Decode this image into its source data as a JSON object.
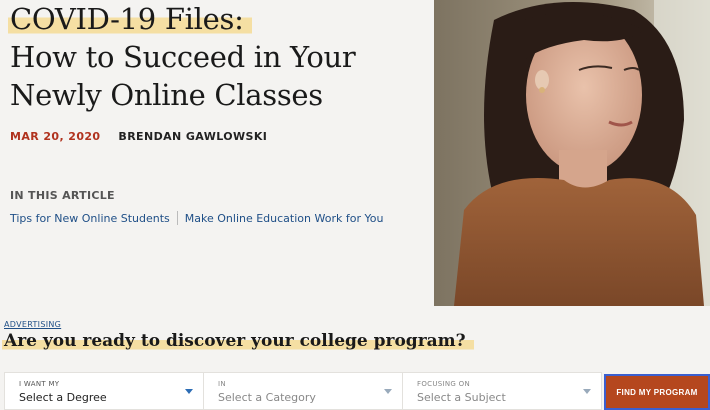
{
  "article": {
    "title_line1": "COVID-19 Files:",
    "title_line2": "How to Succeed in Your",
    "title_line3": "Newly Online Classes",
    "date": "MAR 20, 2020",
    "author": "BRENDAN GAWLOWSKI",
    "in_this_article": "IN THIS ARTICLE",
    "links": [
      "Tips for New Online Students",
      "Make Online Education Work for You"
    ]
  },
  "advertising": {
    "label": "ADVERTISING",
    "prompt": "Are you ready to discover your college program?"
  },
  "search": {
    "fields": [
      {
        "label": "I WANT MY",
        "value": "Select a Degree"
      },
      {
        "label": "IN",
        "value": "Select a Category"
      },
      {
        "label": "FOCUSING ON",
        "value": "Select a Subject"
      }
    ],
    "button": "FIND MY PROGRAM"
  },
  "colors": {
    "highlight": "#f5dfa3",
    "date_red": "#b0321e",
    "link_blue": "#1f4f87",
    "button": "#b5471e"
  }
}
